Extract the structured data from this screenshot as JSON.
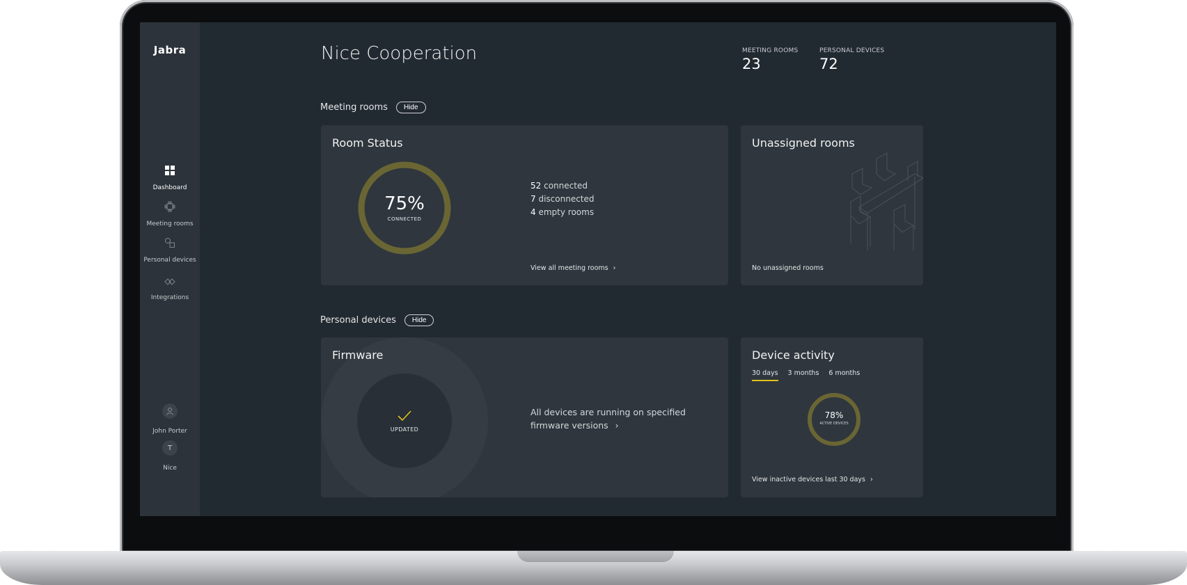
{
  "sidebar": {
    "brand": "Jabra",
    "items": [
      {
        "label": "Dashboard"
      },
      {
        "label": "Meeting rooms"
      },
      {
        "label": "Personal devices"
      },
      {
        "label": "Integrations"
      }
    ],
    "user": {
      "name": "John Porter"
    },
    "org": {
      "initial": "T",
      "name": "Nice"
    }
  },
  "header": {
    "title": "Nice Cooperation",
    "stats": [
      {
        "caption": "MEETING ROOMS",
        "value": "23"
      },
      {
        "caption": "PERSONAL DEVICES",
        "value": "72"
      }
    ]
  },
  "meeting_rooms": {
    "section_label": "Meeting rooms",
    "hide_label": "Hide",
    "room_status": {
      "title": "Room Status",
      "percent": "75%",
      "percent_value": 75,
      "caption": "CONNECTED",
      "connected_num": "52",
      "connected_txt": "connected",
      "disconnected_num": "7",
      "disconnected_txt": "disconnected",
      "empty_num": "4",
      "empty_txt": "empty rooms",
      "link": "View all meeting rooms"
    },
    "unassigned": {
      "title": "Unassigned rooms",
      "empty_text": "No unassigned rooms"
    }
  },
  "personal_devices": {
    "section_label": "Personal devices",
    "hide_label": "Hide",
    "firmware": {
      "title": "Firmware",
      "status": "UPDATED",
      "message_line1": "All devices are running on specified",
      "message_line2": "firmware versions"
    },
    "device_activity": {
      "title": "Device activity",
      "tabs": [
        "30 days",
        "3 months",
        "6 months"
      ],
      "active_tab": "30 days",
      "percent": "78%",
      "percent_value": 78,
      "caption": "ACTIVE DEVICES",
      "link": "View inactive devices last 30 days"
    }
  },
  "colors": {
    "accent": "#e1c21c",
    "ring": "#6a6634",
    "background": "#222a31",
    "card": "#2f363d",
    "sidebar": "#2c333a"
  }
}
